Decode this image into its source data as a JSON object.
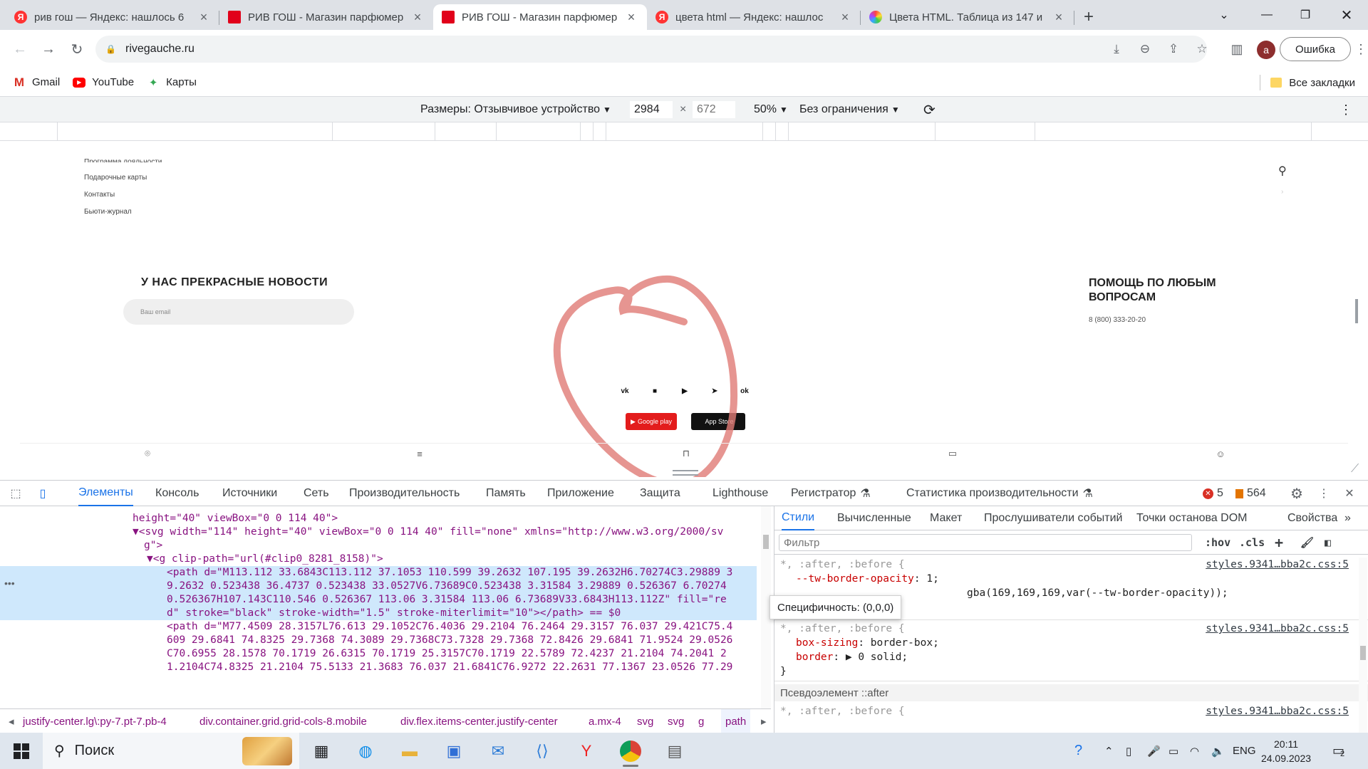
{
  "tabs": [
    {
      "favicon": "yandex-icon",
      "favicon_letter": "Я",
      "title": "рив гош — Яндекс: нашлось 6"
    },
    {
      "favicon": "rivegauche-icon",
      "favicon_letter": "",
      "title": "РИВ ГОШ - Магазин парфюмер"
    },
    {
      "favicon": "rivegauche-icon",
      "favicon_letter": "",
      "title": "РИВ ГОШ - Магазин парфюмер"
    },
    {
      "favicon": "yandex-icon",
      "favicon_letter": "Я",
      "title": "цвета html — Яндекс: нашлос"
    },
    {
      "favicon": "colors-icon",
      "favicon_letter": "",
      "title": "Цвета HTML. Таблица из 147 и"
    }
  ],
  "active_tab_index": 2,
  "omnibox": {
    "url": "rivegauche.ru"
  },
  "profile": {
    "avatar_letter": "a",
    "error_label": "Ошибка"
  },
  "bookmarks": {
    "items": [
      {
        "icon": "gmail-icon",
        "glyph": "M",
        "label": "Gmail"
      },
      {
        "icon": "youtube-icon",
        "glyph": "▶",
        "label": "YouTube"
      },
      {
        "icon": "maps-icon",
        "glyph": "✦",
        "label": "Карты"
      }
    ],
    "all_label": "Все закладки"
  },
  "device_toolbar": {
    "dimensions_label": "Размеры: Отзывчивое устройство",
    "width": "2984",
    "times": "×",
    "height_placeholder": "672",
    "zoom": "50%",
    "throttle": "Без ограничения"
  },
  "site": {
    "menu": [
      "Подарочные карты",
      "Контакты",
      "Бьюти-журнал"
    ],
    "news_title": "У НАС ПРЕКРАСНЫЕ НОВОСТИ",
    "email_placeholder": "Ваш email",
    "help_title": "ПОМОЩЬ ПО ЛЮБЫМ ВОПРОСАМ",
    "help_phone": "8 (800) 333-20-20",
    "social": [
      {
        "icon": "vk-icon",
        "glyph": "vk"
      },
      {
        "icon": "social-square-icon",
        "glyph": "■"
      },
      {
        "icon": "youtube-icon",
        "glyph": "▶"
      },
      {
        "icon": "telegram-icon",
        "glyph": "➤"
      },
      {
        "icon": "odnoklassniki-icon",
        "glyph": "ok"
      }
    ],
    "google_play_label": "Google play",
    "app_store_label": "App Store",
    "annotation_color": "#e07a76"
  },
  "devtools": {
    "tabs": [
      "Элементы",
      "Консоль",
      "Источники",
      "Сеть",
      "Производительность",
      "Память",
      "Приложение",
      "Защита",
      "Lighthouse",
      "Регистратор",
      "Статистика производительности"
    ],
    "error_count": "5",
    "warning_count": "564",
    "dom_lines": [
      {
        "text": "height=\"40\" viewBox=\"0 0 114 40\">"
      },
      {
        "text": "▼<svg width=\"114\" height=\"40\" viewBox=\"0 0 114 40\" fill=\"none\" xmlns=\"http://www.w3.org/2000/sv"
      },
      {
        "text": "g\">"
      },
      {
        "text": "▼<g clip-path=\"url(#clip0_8281_8158)\">"
      },
      {
        "text": "<path d=\"M113.112 33.6843C113.112 37.1053 110.599 39.2632 107.195 39.2632H6.70274C3.29889 3"
      },
      {
        "text": "9.2632 0.523438 36.4737 0.523438 33.0527V6.73689C0.523438 3.31584 3.29889 0.526367 6.70274"
      },
      {
        "text": "0.526367H107.143C110.546 0.526367 113.06 3.31584 113.06 6.73689V33.6843H113.112Z\" fill=\"re"
      },
      {
        "text": "d\" stroke=\"black\" stroke-width=\"1.5\" stroke-miterlimit=\"10\"></path> == $0"
      },
      {
        "text": "<path d=\"M77.4509 28.3157L76.613 29.1052C76.4036 29.2104 76.2464 29.3157 76.037 29.421C75.4"
      },
      {
        "text": "609 29.6841 74.8325 29.7368 74.3089 29.7368C73.7328 29.7368 72.8426 29.6841 71.9524 29.0526"
      },
      {
        "text": "C70.6955 28.1578 70.1719 26.6315 70.1719 25.3157C70.1719 22.5789 72.4237 21.2104 74.2041 2"
      },
      {
        "text": "1.2104C74.8325 21.2104 75.5133 21.3683 76.037 21.6841C76.9272 22.2631 77.1367 23.0526 77.29"
      }
    ],
    "breadcrumbs": [
      "justify-center.lg\\:py-7.pt-7.pb-4",
      "div.container.grid.grid-cols-8.mobile",
      "div.flex.items-center.justify-center",
      "a.mx-4",
      "svg",
      "svg",
      "g",
      "path"
    ],
    "styles_tabs": [
      "Стили",
      "Вычисленные",
      "Макет",
      "Прослушиватели событий",
      "Точки останова DOM",
      "Свойства"
    ],
    "filter_placeholder": "Фильтр",
    "hov": ":hov",
    "cls": ".cls",
    "rules": [
      {
        "selector": "*, :after, :before {",
        "source": "styles.9341…bba2c.css:5",
        "decls": [
          {
            "prop": "--tw-border-opacity",
            "value": "1;"
          },
          {
            "prop": "",
            "value": "gba(169,169,169,var(--tw-border-opacity));"
          }
        ]
      },
      {
        "selector": "*, :after, :before {",
        "source": "styles.9341…bba2c.css:5",
        "decls": [
          {
            "prop": "box-sizing",
            "value": "border-box;"
          },
          {
            "prop": "border",
            "value": "▶ 0 solid;"
          }
        ]
      }
    ],
    "pseudo_label": "Псевдоэлемент ::after",
    "last_rule_selector": "*, :after, :before {",
    "last_rule_source": "styles.9341…bba2c.css:5",
    "tooltip": "Специфичность: (0,0,0)"
  },
  "taskbar": {
    "search_label": "Поиск",
    "lang": "ENG",
    "time": "20:11",
    "date": "24.09.2023",
    "notifications": "2"
  }
}
